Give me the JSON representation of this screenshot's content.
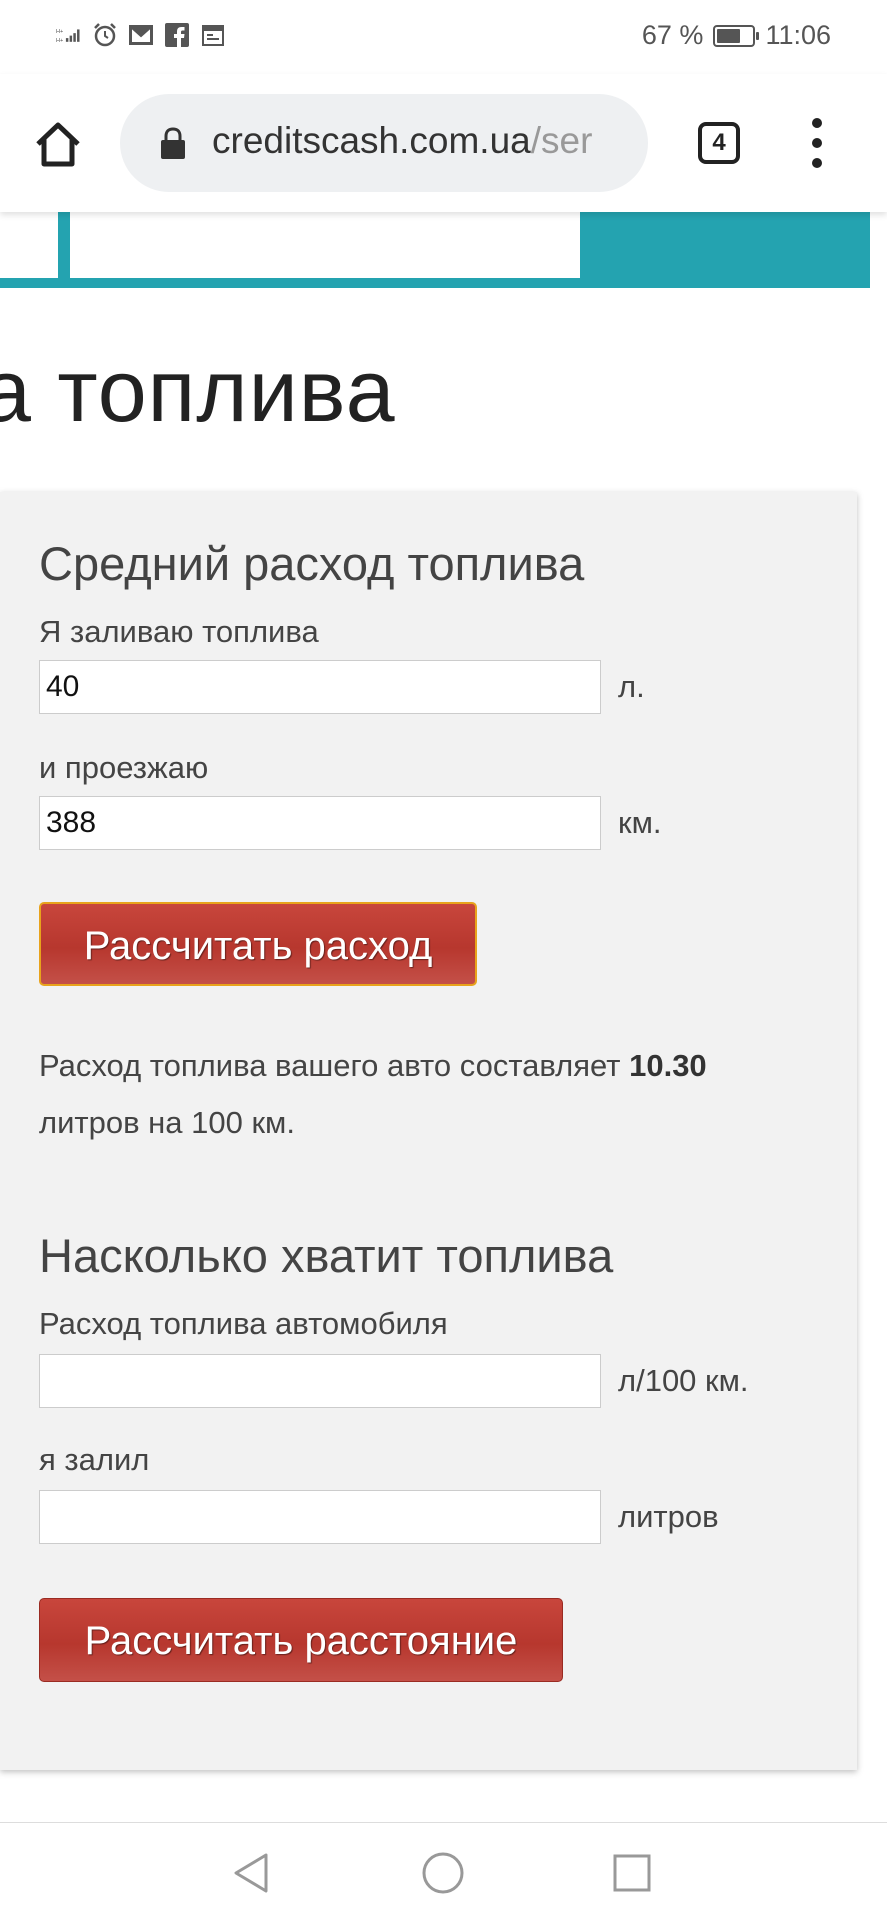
{
  "status": {
    "battery_text": "67 %",
    "battery_level": 0.67,
    "time": "11:06"
  },
  "browser": {
    "url_domain": "creditscash.com.ua",
    "url_path": "/ser",
    "tab_count": "4"
  },
  "page": {
    "title_fragment": "а топлива"
  },
  "calc1": {
    "heading": "Средний расход топлива",
    "fuel_label": "Я заливаю топлива",
    "fuel_value": "40",
    "fuel_unit": "л.",
    "distance_label": "и проезжаю",
    "distance_value": "388",
    "distance_unit": "км.",
    "button_label": "Рассчитать расход",
    "result_prefix": "Расход топлива вашего авто составляет",
    "result_value": "10.30",
    "result_suffix": "литров на 100 км."
  },
  "calc2": {
    "heading": "Насколько хватит топлива",
    "consumption_label": "Расход топлива автомобиля",
    "consumption_value": "",
    "consumption_unit": "л/100 км.",
    "fuel_label": "я залил",
    "fuel_value": "",
    "fuel_unit": "литров",
    "button_label": "Рассчитать расстояние"
  },
  "icons": {
    "status_left": [
      "signal-icon",
      "alarm-icon",
      "gmail-icon",
      "facebook-icon",
      "calendar-icon"
    ],
    "nav": [
      "back-icon",
      "home-circle-icon",
      "recents-icon"
    ]
  }
}
